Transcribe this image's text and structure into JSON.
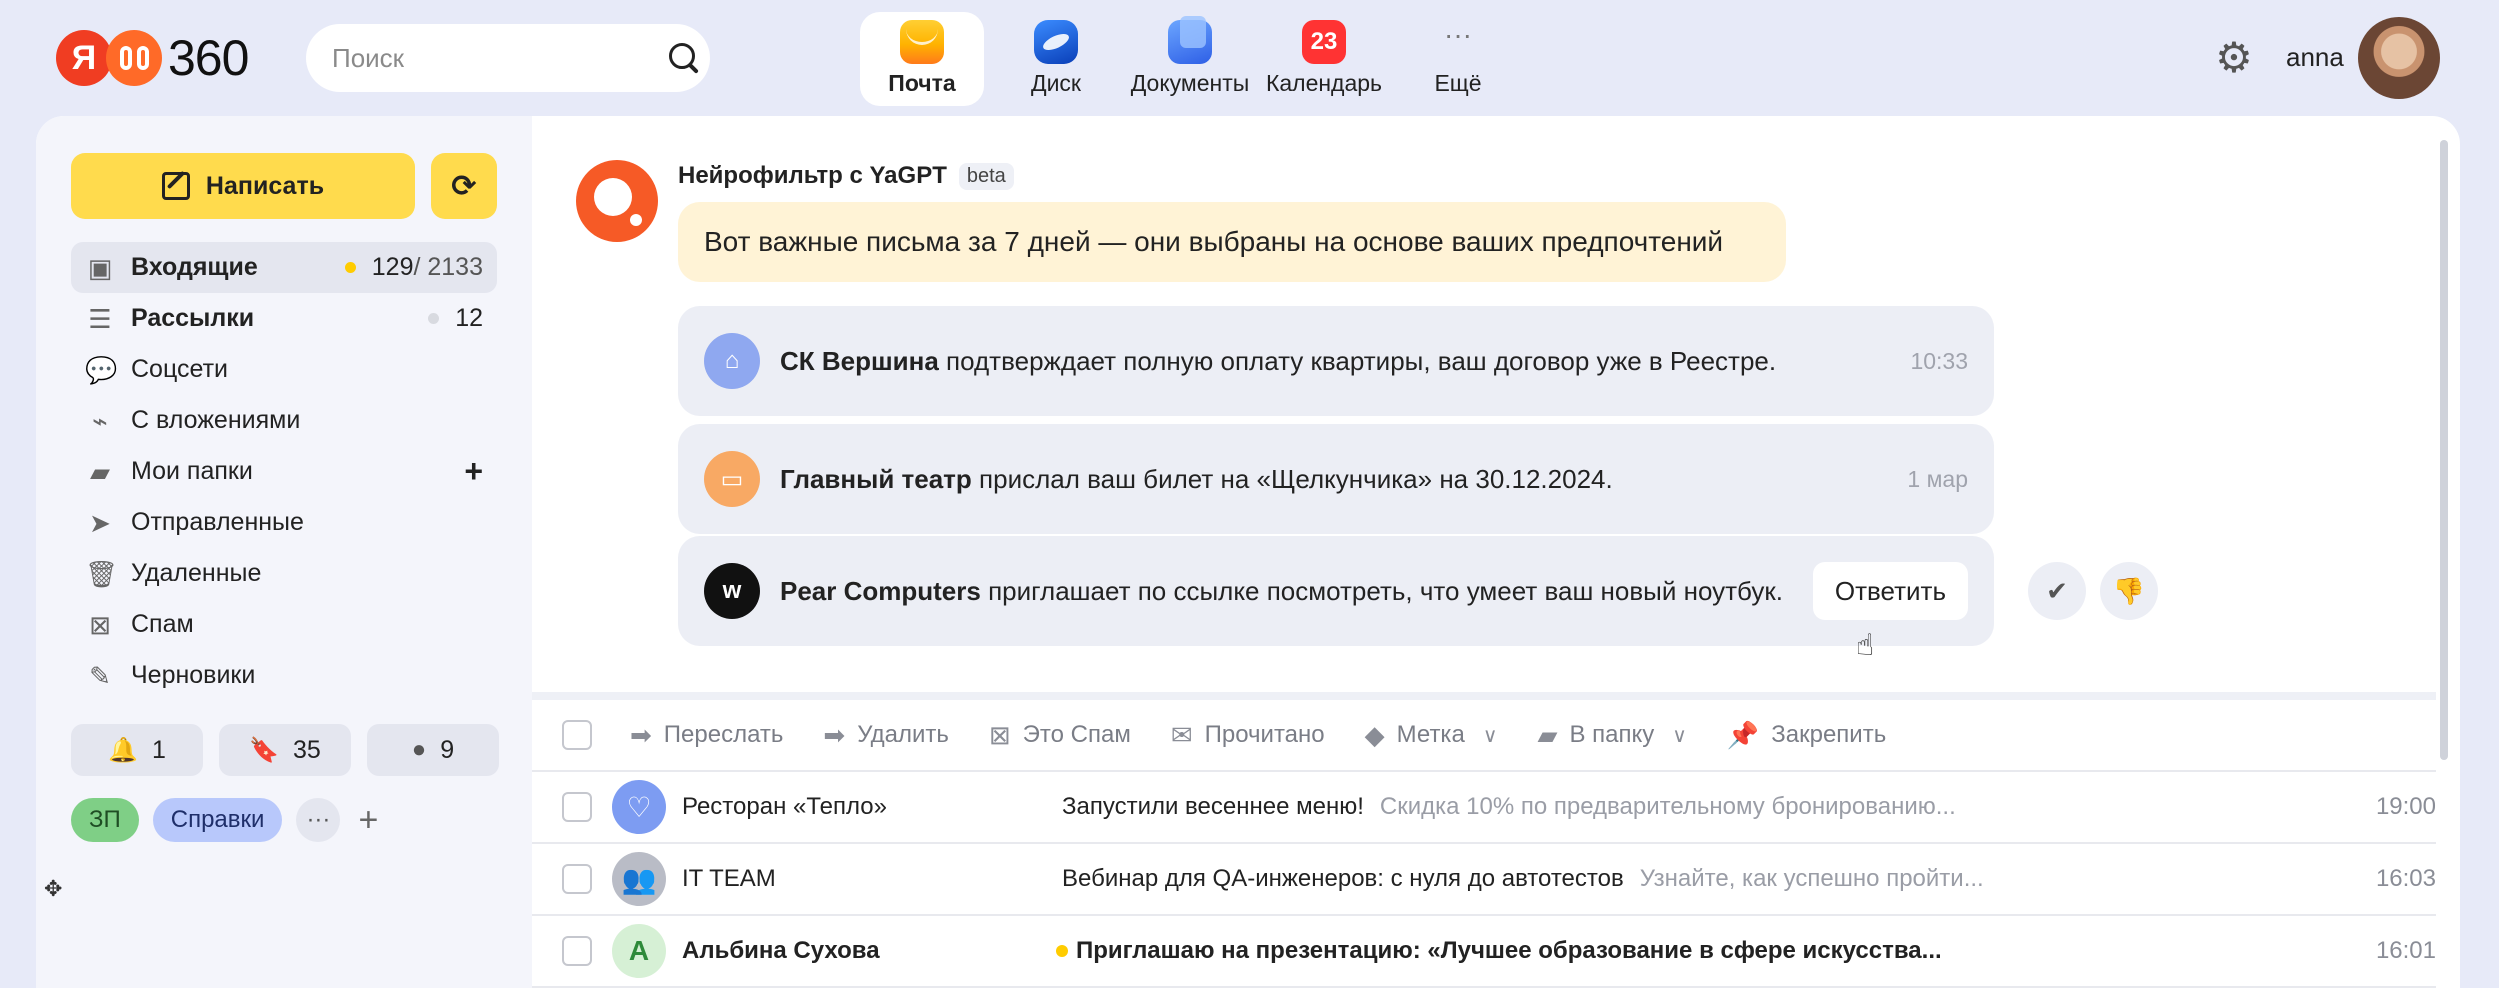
{
  "header": {
    "logo_text": "360",
    "search_placeholder": "Поиск",
    "services": [
      {
        "label": "Почта",
        "icon": "mail-icon"
      },
      {
        "label": "Диск",
        "icon": "disk-icon"
      },
      {
        "label": "Документы",
        "icon": "docs-icon"
      },
      {
        "label": "Календарь",
        "icon": "calendar-icon",
        "badge": "23"
      },
      {
        "label": "Ещё",
        "icon": "more-icon"
      }
    ],
    "username": "anna"
  },
  "sidebar": {
    "compose_label": "Написать",
    "folders": [
      {
        "name": "Входящие",
        "unread": "129",
        "total": "/ 2133",
        "icon": "inbox-icon"
      },
      {
        "name": "Рассылки",
        "count": "12",
        "icon": "newsletter-icon"
      },
      {
        "name": "Соцсети",
        "icon": "social-icon"
      },
      {
        "name": "С вложениями",
        "icon": "paperclip-icon"
      },
      {
        "name": "Мои папки",
        "icon": "folder-icon"
      },
      {
        "name": "Отправленные",
        "icon": "send-icon"
      },
      {
        "name": "Удаленные",
        "icon": "trash-icon"
      },
      {
        "name": "Спам",
        "icon": "spam-icon"
      },
      {
        "name": "Черновики",
        "icon": "drafts-icon"
      }
    ],
    "counters": [
      {
        "icon": "bell-icon",
        "value": "1"
      },
      {
        "icon": "bookmark-icon",
        "value": "35"
      },
      {
        "icon": "dot-icon",
        "value": "9"
      }
    ],
    "labels": [
      "ЗП",
      "Справки"
    ]
  },
  "neurofilter": {
    "title": "Нейрофильтр с YaGPT",
    "beta": "beta",
    "intro": "Вот важные письма за 7 дней — они выбраны на основе ваших предпочтений",
    "cards": [
      {
        "sender": "СК Вершина",
        "text": "подтверждает полную оплату квартиры, ваш договор уже в Реестре.",
        "time": "10:33",
        "color": "#8fa8f0"
      },
      {
        "sender": "Главный театр",
        "text": "прислал ваш билет на «Щелкунчика» на 30.12.2024.",
        "time": "1 мар",
        "color": "#f8a964"
      },
      {
        "sender": "Pear Computers",
        "text": "приглашает по ссылке посмотреть, что умеет ваш новый ноутбук.",
        "reply": "Ответить",
        "avatar_letter": "w",
        "color": "#111111"
      }
    ]
  },
  "toolbar": {
    "actions": [
      {
        "label": "Переслать",
        "icon": "forward-icon"
      },
      {
        "label": "Удалить",
        "icon": "delete-icon"
      },
      {
        "label": "Это Спам",
        "icon": "spam-icon"
      },
      {
        "label": "Прочитано",
        "icon": "read-icon"
      },
      {
        "label": "Метка",
        "icon": "tag-icon"
      },
      {
        "label": "В папку",
        "icon": "folder-icon"
      },
      {
        "label": "Закрепить",
        "icon": "pin-icon"
      }
    ]
  },
  "messages": [
    {
      "sender": "Ресторан «Тепло»",
      "subject": "Запустили весеннее меню!",
      "preview": "Скидка 10% по предварительному бронированию...",
      "time": "19:00"
    },
    {
      "sender": "IT TEAM",
      "subject": "Вебинар для QA-инженеров: с нуля до автотестов",
      "preview": "Узнайте, как успешно пройти...",
      "time": "16:03"
    },
    {
      "sender": "Альбина Сухова",
      "subject": "Приглашаю на презентацию: «Лучшее образование в сфере искусства...",
      "preview": "",
      "time": "16:01",
      "avatar_letter": "A"
    }
  ]
}
